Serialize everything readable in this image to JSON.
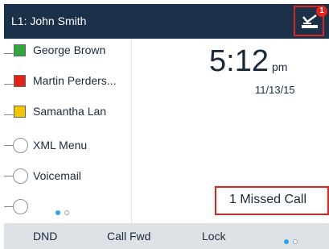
{
  "header": {
    "line_label": "L1: John Smith",
    "icon": "missed-call-icon",
    "badge_count": "1",
    "accent": "#e2231a",
    "background": "#1b3049"
  },
  "line_keys": [
    {
      "label": "George Brown",
      "status_color": "#2eaa3c",
      "icon": "status-square"
    },
    {
      "label": "Martin Perders...",
      "status_color": "#e2231a",
      "icon": "status-square"
    },
    {
      "label": "Samantha Lan",
      "status_color": "#f5c400",
      "icon": "status-square"
    },
    {
      "label": "XML Menu",
      "icon": "circle-icon"
    },
    {
      "label": "Voicemail",
      "icon": "circle-icon"
    },
    {
      "label": "",
      "icon": "circle-icon"
    }
  ],
  "pager": {
    "current": 1,
    "total": 2
  },
  "clock": {
    "time": "5:12",
    "ampm": "pm",
    "date": "11/13/15"
  },
  "notification": {
    "text": "1  Missed Call"
  },
  "softkeys": [
    {
      "label": "DND"
    },
    {
      "label": "Call Fwd"
    },
    {
      "label": "Lock"
    }
  ],
  "softkey_pager": {
    "current": 1,
    "total": 2
  }
}
